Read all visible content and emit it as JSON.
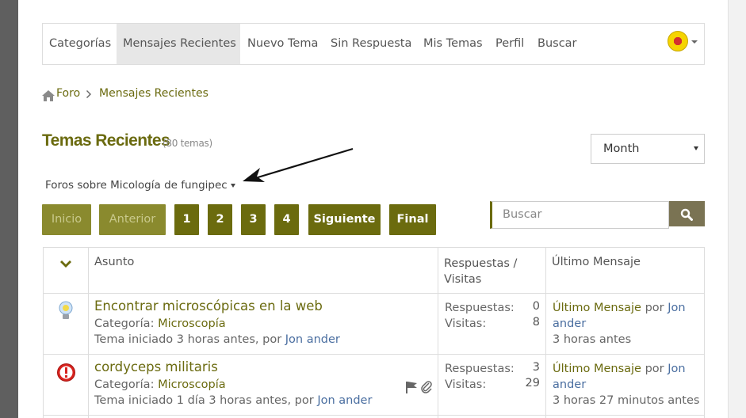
{
  "nav": {
    "items": [
      "Categorías",
      "Mensajes Recientes",
      "Nuevo Tema",
      "Sin Respuesta",
      "Mis Temas",
      "Perfil",
      "Buscar"
    ],
    "active_index": 1
  },
  "breadcrumb": {
    "home": "Foro",
    "current": "Mensajes Recientes"
  },
  "header": {
    "title": "Temas Recientes",
    "count": "(80 temas)"
  },
  "filter": {
    "period": "Month",
    "forum": "Foros sobre Micología de fungipec"
  },
  "pagination": {
    "first": "Inicio",
    "prev": "Anterior",
    "pages": [
      "1",
      "2",
      "3",
      "4"
    ],
    "next": "Siguiente",
    "last": "Final"
  },
  "search": {
    "placeholder": "Buscar"
  },
  "table": {
    "col_subject": "Asunto",
    "col_stats": "Respuestas / Visitas",
    "col_last": "Último Mensaje",
    "rows": [
      {
        "icon": "lightbulb-icon",
        "title": "Encontrar microscópicas en la web",
        "category_label": "Categoría:",
        "category": "Microscopía",
        "started": "Tema iniciado 3 horas antes, por",
        "author": "Jon ander",
        "replies_label": "Respuestas:",
        "replies": "0",
        "views_label": "Visitas:",
        "views": "8",
        "last_link": "Último Mensaje",
        "last_by": "por",
        "last_author": "Jon ander",
        "last_time": "3 horas antes"
      },
      {
        "icon": "alert-icon",
        "title": "cordyceps militaris",
        "category_label": "Categoría:",
        "category": "Microscopía",
        "started": "Tema iniciado 1 día 3 horas antes, por",
        "author": "Jon ander",
        "replies_label": "Respuestas:",
        "replies": "3",
        "views_label": "Visitas:",
        "views": "29",
        "last_link": "Último Mensaje",
        "last_by": "por",
        "last_author": "Jon ander",
        "last_time": "3 horas 27 minutos antes"
      }
    ]
  }
}
